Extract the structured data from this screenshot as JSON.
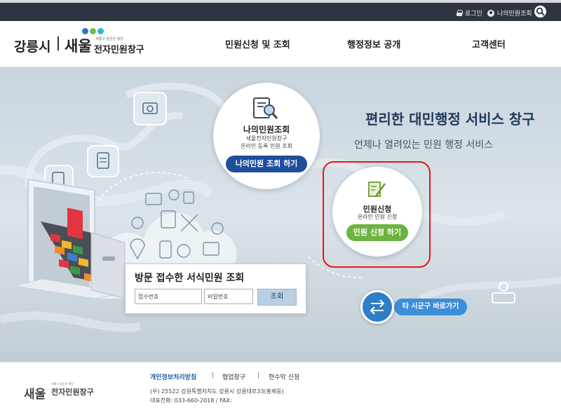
{
  "topbar": {
    "login_label": "로그인",
    "my_petition_label": "나의민원조회"
  },
  "header": {
    "city": "강릉시",
    "brand": "새울",
    "brand_sub": "새롭고 올곧은 행정",
    "brand_portal": "전자민원창구",
    "nav": [
      "민원신청 및 조회",
      "행정정보 공개",
      "고객센터"
    ]
  },
  "hero": {
    "title": "편리한 대민행정 서비스 창구",
    "subtitle": "언제나 열려있는 민원 행정 서비스",
    "my_card": {
      "title": "나의민원조회",
      "desc_line1": "새울전자민원창구",
      "desc_line2": "온라인 등록 민원 조회",
      "button": "나의민원 조회 하기"
    },
    "apply_card": {
      "title": "민원신청",
      "desc": "온라인 민원 신청",
      "button": "민원 신청 하기"
    },
    "other_city_button": "타 시군구 바로가기"
  },
  "lookup": {
    "title": "방문 접수한 서식민원 조회",
    "receipt_placeholder": "접수번호",
    "password_placeholder": "비밀번호",
    "submit_label": "조회"
  },
  "footer": {
    "brand": "새울",
    "brand_sub": "새롭고 올곧은 행정",
    "brand_portal": "전자민원창구",
    "links": [
      "개인정보처리방침",
      "협업창구",
      "현수막 신청"
    ],
    "address": "(우) 25522 강원특별자치도 강릉시 강릉대로33(홍제동)",
    "phone": "대표전화: 033-660-2018 / FAX:"
  },
  "colors": {
    "topbar": "#2f3540",
    "my_button": "#1d4f9c",
    "apply_button": "#6db33f",
    "highlight": "#e8141c",
    "logo_dot_blue": "#2b77c4",
    "logo_dot_green": "#78b843",
    "logo_dot_sky": "#38b2e3"
  },
  "icons": [
    "lock-icon",
    "user-icon",
    "search-icon",
    "magnifier-document-icon",
    "pen-document-icon",
    "exchange-arrows-icon",
    "person-desk-icon",
    "laptop-cabinet-illustration"
  ]
}
